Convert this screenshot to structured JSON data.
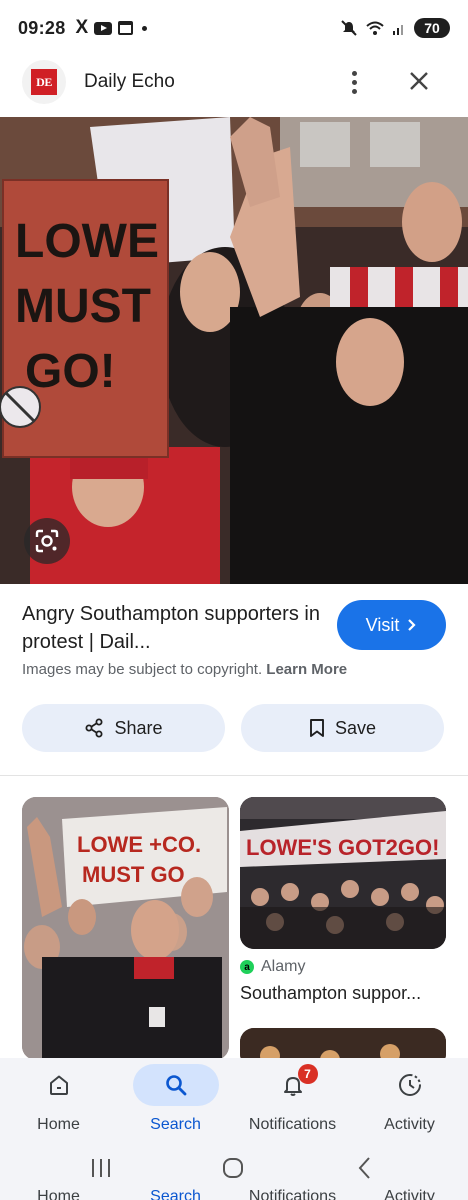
{
  "status_bar": {
    "time": "09:28",
    "x_icon": "X",
    "battery": "70"
  },
  "header": {
    "logo_text": "DE",
    "site_name": "Daily Echo"
  },
  "main_image": {
    "sign_lines": [
      "LOWE",
      "MUST",
      "GO!"
    ]
  },
  "result": {
    "title": "Angry Southampton supporters in protest | Dail...",
    "copyright_text": "Images may be subject to copyright.",
    "learn_more": "Learn More",
    "visit_label": "Visit"
  },
  "actions": {
    "share_label": "Share",
    "save_label": "Save"
  },
  "related": {
    "card1_banner": [
      "LOWE +CO.",
      "MUST GO"
    ],
    "card2_banner": "LOWE'S GOT2GO!",
    "card2_source_icon": "a",
    "card2_source": "Alamy",
    "card2_title": "Southampton suppor..."
  },
  "bottom_nav": {
    "items": [
      {
        "label": "Home",
        "icon": "home-icon"
      },
      {
        "label": "Search",
        "icon": "search-icon"
      },
      {
        "label": "Notifications",
        "icon": "bell-icon",
        "badge": "7"
      },
      {
        "label": "Activity",
        "icon": "activity-icon"
      }
    ],
    "active": "Search"
  },
  "colors": {
    "accent": "#1a73e8",
    "active_nav_pill": "#d3e3fd",
    "pill_button_bg": "#e8eef9",
    "brand_red": "#d01f25"
  }
}
